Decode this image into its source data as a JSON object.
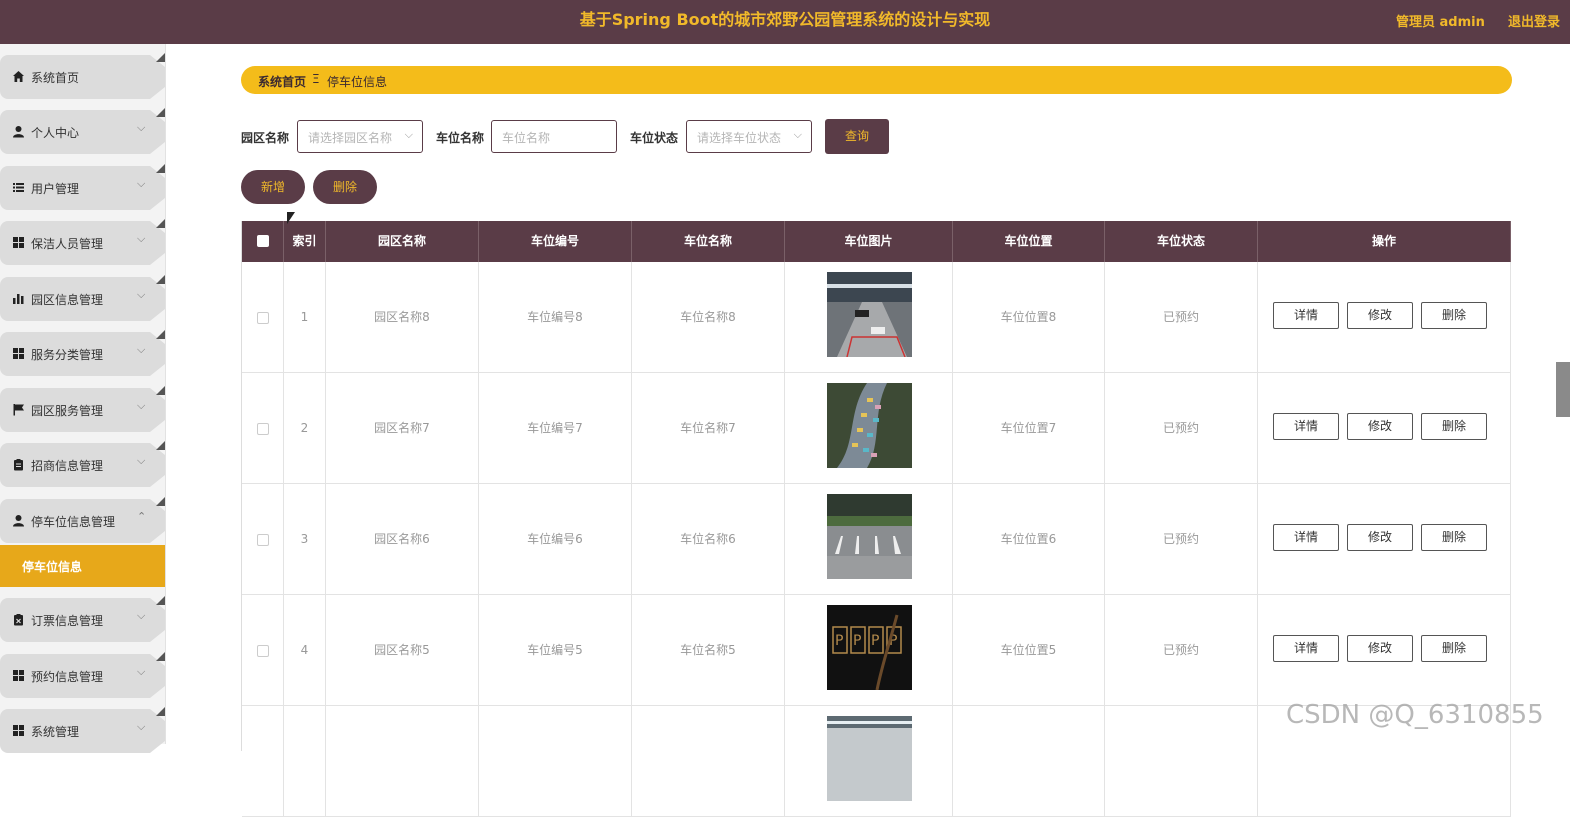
{
  "header": {
    "title": "基于Spring Boot的城市郊野公园管理系统的设计与实现",
    "user": "管理员 admin",
    "logout": "退出登录"
  },
  "sidebar": {
    "items": [
      {
        "label": "系统首页",
        "icon": "home-icon",
        "chevron": ""
      },
      {
        "label": "个人中心",
        "icon": "user-icon",
        "chevron": "⌵"
      },
      {
        "label": "用户管理",
        "icon": "list-icon",
        "chevron": "⌵"
      },
      {
        "label": "保洁人员管理",
        "icon": "grid-icon",
        "chevron": "⌵"
      },
      {
        "label": "园区信息管理",
        "icon": "bar-chart-icon",
        "chevron": "⌵"
      },
      {
        "label": "服务分类管理",
        "icon": "grid-icon",
        "chevron": "⌵"
      },
      {
        "label": "园区服务管理",
        "icon": "flag-icon",
        "chevron": "⌵"
      },
      {
        "label": "招商信息管理",
        "icon": "clipboard-icon",
        "chevron": "⌵"
      },
      {
        "label": "停车位信息管理",
        "icon": "user-icon",
        "chevron": "⌃"
      },
      {
        "label": "订票信息管理",
        "icon": "clipboard-x-icon",
        "chevron": "⌵"
      },
      {
        "label": "预约信息管理",
        "icon": "grid-icon",
        "chevron": "⌵"
      },
      {
        "label": "系统管理",
        "icon": "grid-icon",
        "chevron": "⌵"
      }
    ],
    "active_sub": "停车位信息"
  },
  "breadcrumb": {
    "home": "系统首页",
    "separator": "Ξ",
    "current": "停车位信息"
  },
  "filters": {
    "park_label": "园区名称",
    "park_placeholder": "请选择园区名称",
    "space_label": "车位名称",
    "space_placeholder": "车位名称",
    "status_label": "车位状态",
    "status_placeholder": "请选择车位状态",
    "query": "查询"
  },
  "actions": {
    "add": "新增",
    "delete": "删除"
  },
  "table": {
    "columns": [
      "索引",
      "园区名称",
      "车位编号",
      "车位名称",
      "车位图片",
      "车位位置",
      "车位状态",
      "操作"
    ],
    "rows": [
      {
        "index": "1",
        "park": "园区名称8",
        "code": "车位编号8",
        "name": "车位名称8",
        "location": "车位位置8",
        "status": "已预约"
      },
      {
        "index": "2",
        "park": "园区名称7",
        "code": "车位编号7",
        "name": "车位名称7",
        "location": "车位位置7",
        "status": "已预约"
      },
      {
        "index": "3",
        "park": "园区名称6",
        "code": "车位编号6",
        "name": "车位名称6",
        "location": "车位位置6",
        "status": "已预约"
      },
      {
        "index": "4",
        "park": "园区名称5",
        "code": "车位编号5",
        "name": "车位名称5",
        "location": "车位位置5",
        "status": "已预约"
      },
      {
        "index": "",
        "park": "",
        "code": "",
        "name": "",
        "location": "",
        "status": ""
      }
    ],
    "row_actions": {
      "detail": "详情",
      "edit": "修改",
      "delete": "删除"
    }
  },
  "watermark": "CSDN @Q_6310855",
  "colors": {
    "brand": "#5a3c47",
    "accent": "#f1b92a",
    "active": "#e7a81a"
  }
}
